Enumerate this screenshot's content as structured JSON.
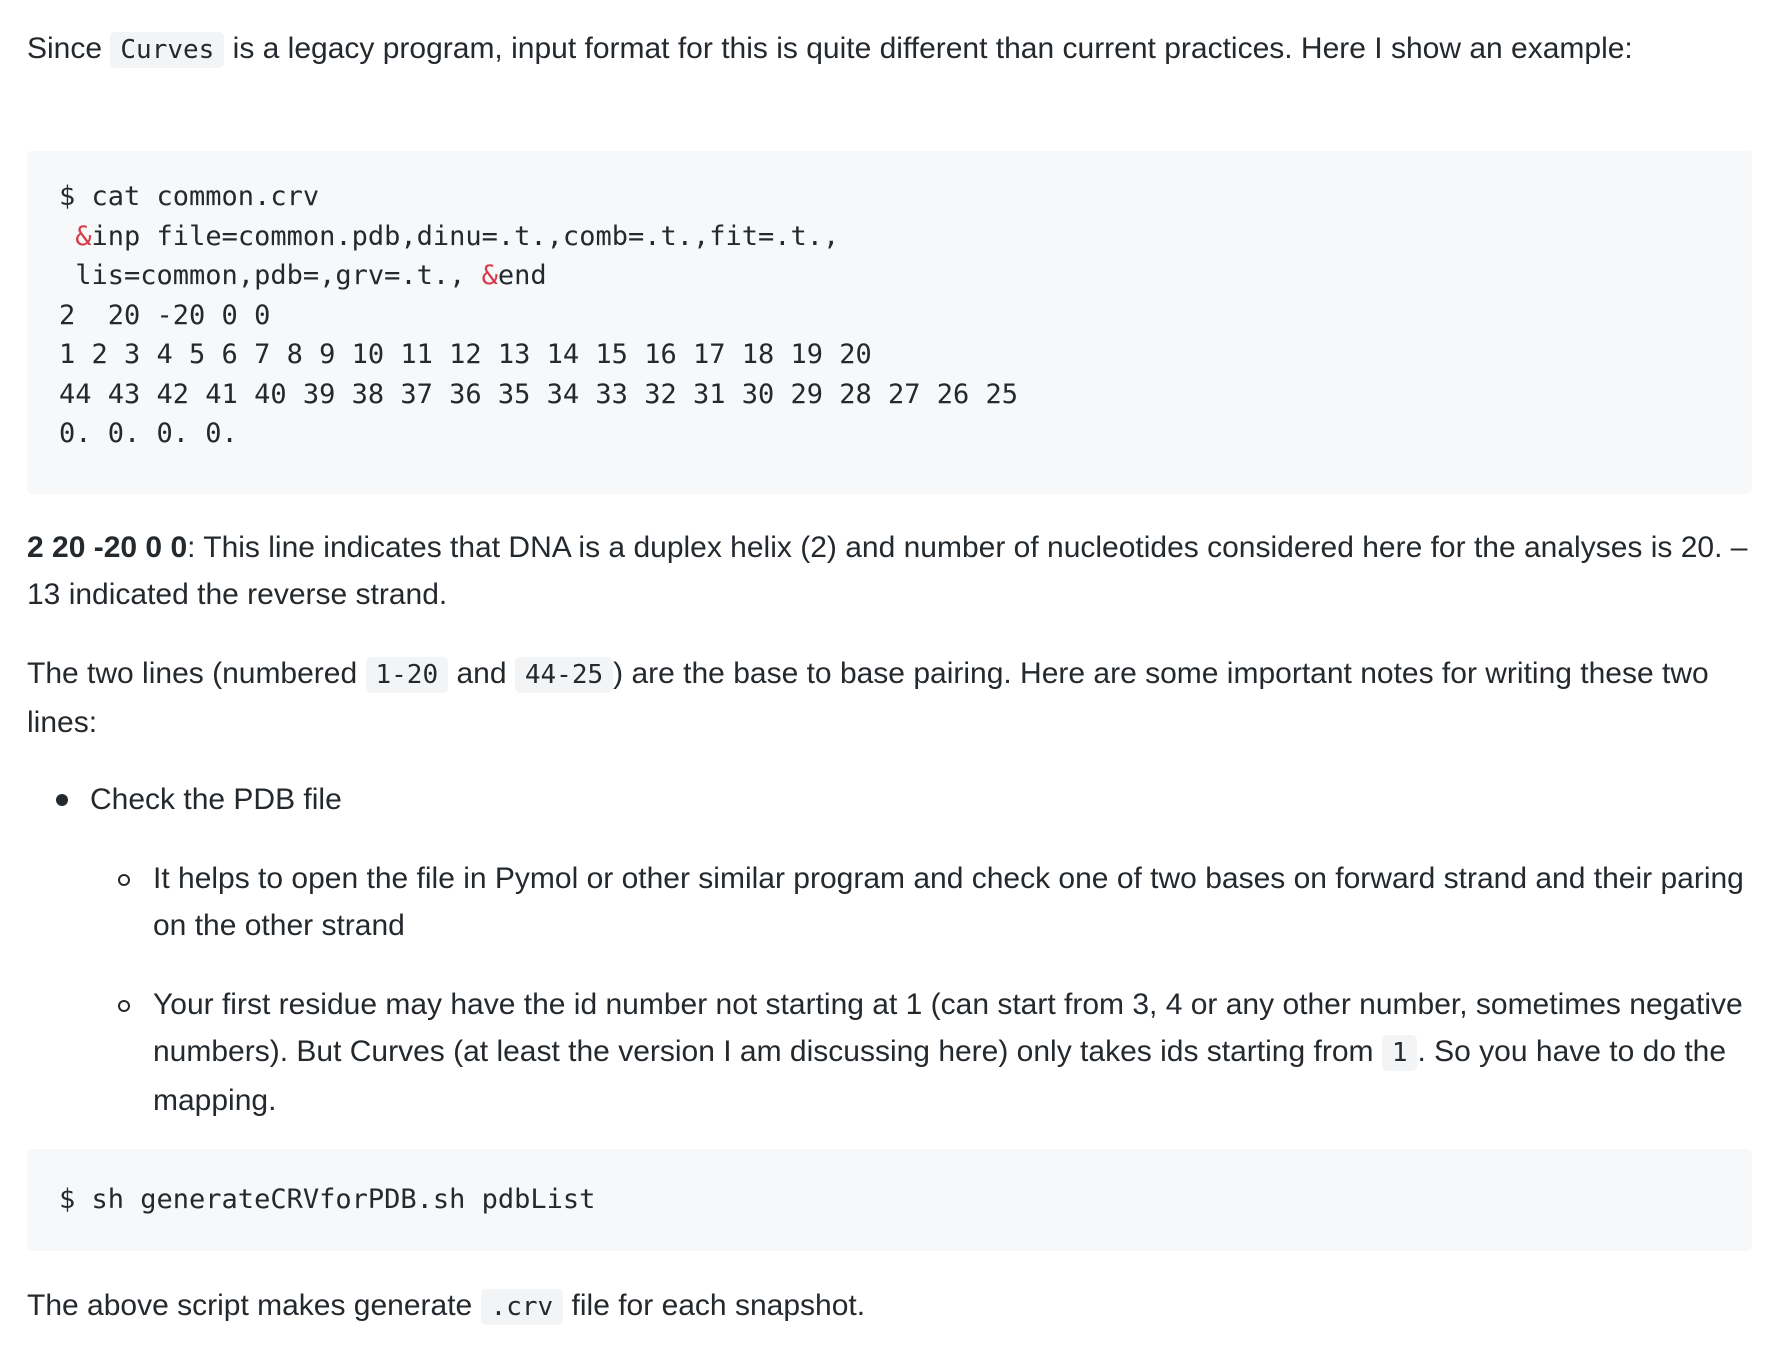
{
  "para1": {
    "t1": "Since ",
    "code": "Curves",
    "t2": " is a legacy program, input format for this is quite different than current practices. Here I show an example:"
  },
  "code_block1": {
    "line1": "$ cat common.crv",
    "line2_amp": "&",
    "line2_rest": "inp file=common.pdb,dinu=.t.,comb=.t.,fit=.t.,",
    "line3_start": " lis=common,pdb=,grv=.t., ",
    "line3_amp": "&",
    "line3_end": "end",
    "line4": "2  20 -20 0 0",
    "line5": "1 2 3 4 5 6 7 8 9 10 11 12 13 14 15 16 17 18 19 20",
    "line6": "44 43 42 41 40 39 38 37 36 35 34 33 32 31 30 29 28 27 26 25",
    "line7": "0. 0. 0. 0."
  },
  "para2": {
    "bold": "2 20 -20 0 0",
    "text": ": This line indicates that DNA is a duplex helix (2) and number of nucleotides considered here for the analyses is 20. –13 indicated the reverse strand."
  },
  "para3": {
    "t1": "The two lines (numbered ",
    "code1": "1-20",
    "t2": " and ",
    "code2": "44-25",
    "t3": ") are the base to base pairing. Here are some important notes for writing these two lines:"
  },
  "list": {
    "item1": "Check the PDB file",
    "sub1": "It helps to open the file in Pymol or other similar program and check one of two bases on forward strand and their paring on the other strand",
    "sub2_t1": "Your first residue may have the id number not starting at 1 (can start from 3, 4 or any other number, sometimes negative numbers). But Curves (at least the version I am discussing here) only takes ids starting from ",
    "sub2_code": "1",
    "sub2_t2": ". So you have to do the mapping."
  },
  "code_block2": {
    "line1": "$ sh generateCRVforPDB.sh pdbList"
  },
  "para4": {
    "t1": "The above script makes generate ",
    "code": ".crv",
    "t2": " file for each snapshot."
  }
}
